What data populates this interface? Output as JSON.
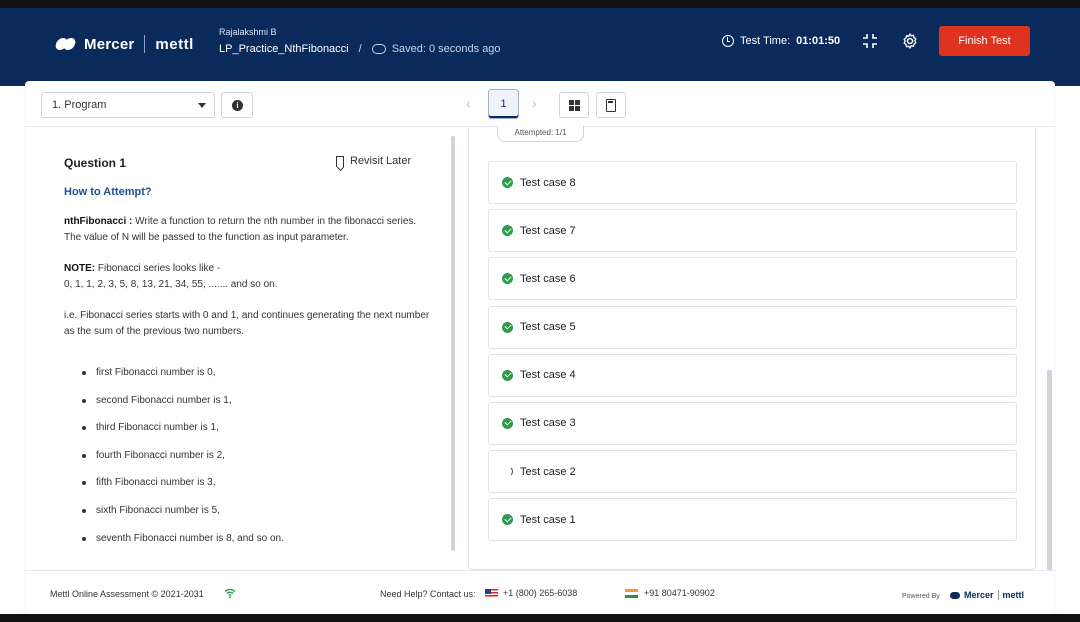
{
  "header": {
    "brand_mercer": "Mercer",
    "brand_mettl": "mettl",
    "user_name": "Rajalakshmi B",
    "test_name": "LP_Practice_NthFibonacci",
    "separator": "/",
    "saved_status": "Saved: 0 seconds ago",
    "timer_label": "Test Time:",
    "timer_value": "01:01:50",
    "finish_label": "Finish Test",
    "colors": {
      "header_bg": "#0b2a5c",
      "finish_bg": "#e0331f"
    }
  },
  "toolbar": {
    "section_select": "1. Program",
    "info_icon": "info-icon",
    "prev_glyph": "‹",
    "page_number": "1",
    "next_glyph": "›",
    "grid_icon": "grid-icon",
    "calculator_icon": "calculator-icon"
  },
  "question": {
    "title": "Question 1",
    "revisit_label": "Revisit Later",
    "how_to": "How to Attempt?",
    "func_name": "nthFibonacci :",
    "func_desc": "Write a function to return the nth number in the fibonacci series.",
    "param_desc": "The value of N will be passed to the function as input parameter.",
    "note_label": "NOTE:",
    "note_text": "Fibonacci series looks like -",
    "series": "0, 1, 1, 2, 3, 5, 8, 13, 21, 34, 55, ....... and so on.",
    "explain": "i.e. Fibonacci series starts with 0 and 1, and continues generating the next number as the sum of the previous two numbers.",
    "bullets": [
      "first Fibonacci number is 0,",
      "second Fibonacci number is 1,",
      "third Fibonacci number is 1,",
      "fourth Fibonacci number is 2,",
      "fifth Fibonacci number is 3,",
      "sixth Fibonacci number is 5,",
      "seventh Fibonacci number is 8, and so on."
    ]
  },
  "results": {
    "attempted": "Attempted: 1/1",
    "test_cases": [
      {
        "label": "Test case 8",
        "status": "passed"
      },
      {
        "label": "Test case 7",
        "status": "passed"
      },
      {
        "label": "Test case 6",
        "status": "passed"
      },
      {
        "label": "Test case 5",
        "status": "passed"
      },
      {
        "label": "Test case 4",
        "status": "passed"
      },
      {
        "label": "Test case 3",
        "status": "passed"
      },
      {
        "label": "Test case 2",
        "status": "running"
      },
      {
        "label": "Test case 1",
        "status": "passed"
      }
    ]
  },
  "footer": {
    "copyright": "Mettl Online Assessment © 2021-2031",
    "help_label": "Need Help? Contact us:",
    "us_phone": "+1 (800) 265-6038",
    "in_phone": "+91 80471-90902",
    "powered_by": "Powered By",
    "powered_mercer": "Mercer",
    "powered_mettl": "mettl"
  }
}
